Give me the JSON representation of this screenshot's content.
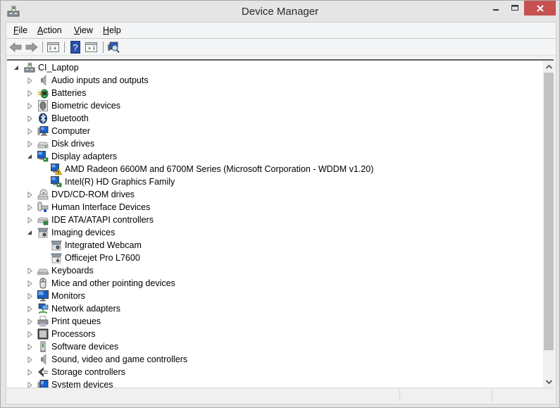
{
  "window": {
    "title": "Device Manager",
    "controls": {
      "minimize": "minimize",
      "maximize": "maximize",
      "close": "close"
    }
  },
  "menu": [
    {
      "label": "File",
      "accel": "F",
      "rest": "ile"
    },
    {
      "label": "Action",
      "accel": "A",
      "rest": "ction"
    },
    {
      "label": "View",
      "accel": "V",
      "rest": "iew"
    },
    {
      "label": "Help",
      "accel": "H",
      "rest": "elp"
    }
  ],
  "toolbar": [
    {
      "name": "back-button",
      "icon": "arrow-left-icon",
      "enabled": false
    },
    {
      "name": "forward-button",
      "icon": "arrow-right-icon",
      "enabled": false
    },
    {
      "name": "show-hide-console-tree-button",
      "icon": "console-tree-icon"
    },
    {
      "name": "help-button",
      "icon": "help-icon"
    },
    {
      "name": "show-hide-action-pane-button",
      "icon": "action-pane-icon"
    },
    {
      "name": "scan-hardware-changes-button",
      "icon": "scan-hardware-icon"
    }
  ],
  "tree": {
    "root": {
      "label": "CI_Laptop",
      "icon": "computer-root-icon",
      "expanded": true
    },
    "items": [
      {
        "label": "Audio inputs and outputs",
        "icon": "speaker-icon",
        "level": 1,
        "expander": "collapsed"
      },
      {
        "label": "Batteries",
        "icon": "battery-icon",
        "level": 1,
        "expander": "collapsed"
      },
      {
        "label": "Biometric devices",
        "icon": "fingerprint-icon",
        "level": 1,
        "expander": "collapsed"
      },
      {
        "label": "Bluetooth",
        "icon": "bluetooth-icon",
        "level": 1,
        "expander": "collapsed"
      },
      {
        "label": "Computer",
        "icon": "computer-icon",
        "level": 1,
        "expander": "collapsed"
      },
      {
        "label": "Disk drives",
        "icon": "disk-drive-icon",
        "level": 1,
        "expander": "collapsed"
      },
      {
        "label": "Display adapters",
        "icon": "display-adapter-icon",
        "level": 1,
        "expander": "expanded"
      },
      {
        "label": "AMD Radeon 6600M and 6700M Series (Microsoft Corporation - WDDM v1.20)",
        "icon": "display-adapter-warning-icon",
        "level": 2,
        "expander": "none",
        "warning": true
      },
      {
        "label": "Intel(R) HD Graphics Family",
        "icon": "display-adapter-icon",
        "level": 2,
        "expander": "none"
      },
      {
        "label": "DVD/CD-ROM drives",
        "icon": "dvd-drive-icon",
        "level": 1,
        "expander": "collapsed"
      },
      {
        "label": "Human Interface Devices",
        "icon": "hid-icon",
        "level": 1,
        "expander": "collapsed"
      },
      {
        "label": "IDE ATA/ATAPI controllers",
        "icon": "ide-controller-icon",
        "level": 1,
        "expander": "collapsed"
      },
      {
        "label": "Imaging devices",
        "icon": "imaging-device-icon",
        "level": 1,
        "expander": "expanded"
      },
      {
        "label": "Integrated Webcam",
        "icon": "webcam-icon",
        "level": 2,
        "expander": "none"
      },
      {
        "label": "Officejet Pro L7600",
        "icon": "scanner-icon",
        "level": 2,
        "expander": "none"
      },
      {
        "label": "Keyboards",
        "icon": "keyboard-icon",
        "level": 1,
        "expander": "collapsed"
      },
      {
        "label": "Mice and other pointing devices",
        "icon": "mouse-icon",
        "level": 1,
        "expander": "collapsed"
      },
      {
        "label": "Monitors",
        "icon": "monitor-icon",
        "level": 1,
        "expander": "collapsed"
      },
      {
        "label": "Network adapters",
        "icon": "network-adapter-icon",
        "level": 1,
        "expander": "collapsed"
      },
      {
        "label": "Print queues",
        "icon": "printer-icon",
        "level": 1,
        "expander": "collapsed"
      },
      {
        "label": "Processors",
        "icon": "processor-icon",
        "level": 1,
        "expander": "collapsed"
      },
      {
        "label": "Software devices",
        "icon": "software-device-icon",
        "level": 1,
        "expander": "collapsed"
      },
      {
        "label": "Sound, video and game controllers",
        "icon": "speaker-icon",
        "level": 1,
        "expander": "collapsed"
      },
      {
        "label": "Storage controllers",
        "icon": "storage-controller-icon",
        "level": 1,
        "expander": "collapsed"
      },
      {
        "label": "System devices",
        "icon": "system-device-icon",
        "level": 1,
        "expander": "collapsed"
      }
    ]
  },
  "scrollbar": {
    "position_fraction": 0.0,
    "visible_fraction": 0.92
  },
  "statusbar": {
    "panes": [
      "",
      "",
      ""
    ]
  },
  "colors": {
    "close_button": "#c75050",
    "selection_border": "#606060",
    "scroll_thumb": "#c2c2c2"
  }
}
